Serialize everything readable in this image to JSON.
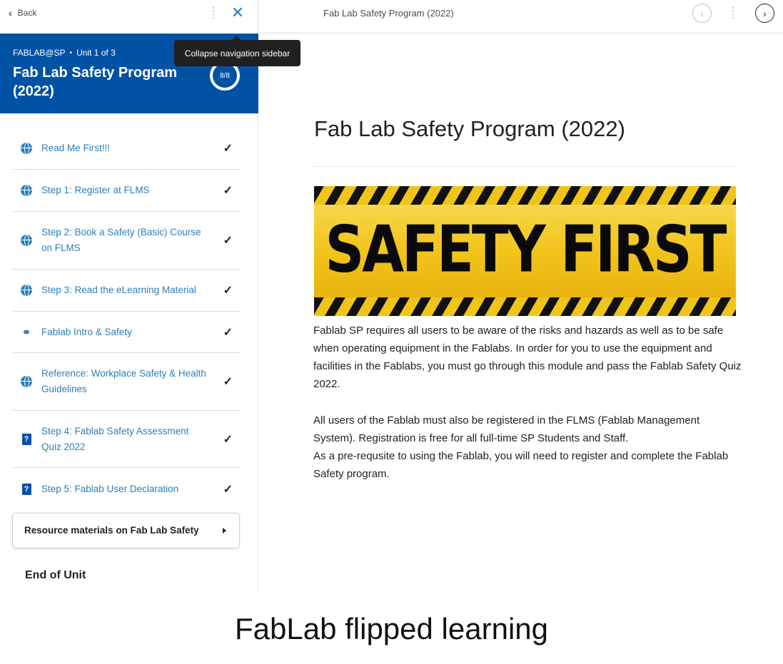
{
  "sidebar": {
    "back_label": "Back",
    "close_tooltip": "Collapse navigation sidebar",
    "unit": {
      "org": "FABLAB@SP",
      "unit_index": "Unit 1 of 3",
      "title": "Fab Lab Safety Program (2022)",
      "progress": "8/8"
    },
    "items": [
      {
        "label": "Read Me First!!!",
        "icon": "globe-icon",
        "completed": true
      },
      {
        "label": "Step 1: Register at FLMS",
        "icon": "globe-icon",
        "completed": true
      },
      {
        "label": "Step 2: Book a Safety (Basic) Course on FLMS",
        "icon": "globe-icon",
        "completed": true
      },
      {
        "label": "Step 3: Read the eLearning Material",
        "icon": "globe-icon",
        "completed": true
      },
      {
        "label": "Fablab Intro & Safety",
        "icon": "link-icon",
        "completed": true
      },
      {
        "label": "Reference: Workplace Safety & Health Guidelines",
        "icon": "globe-icon",
        "completed": true
      },
      {
        "label": "Step 4: Fablab Safety Assessment Quiz 2022",
        "icon": "quiz-icon",
        "completed": true
      },
      {
        "label": "Step 5: Fablab User Declaration",
        "icon": "quiz-icon",
        "completed": true
      }
    ],
    "check_glyph": "✓",
    "resource_section": "Resource materials on Fab Lab Safety",
    "end_label": "End of Unit"
  },
  "main": {
    "topbar_title": "Fab Lab Safety Program (2022)",
    "content_title": "Fab Lab Safety Program (2022)",
    "banner_text": "SAFETY FIRST",
    "paragraph1": "Fablab SP requires all users to be aware of the risks and hazards as well as to be safe when operating equipment in the Fablabs.  In order for you to use the equipment and facilities in the Fablabs, you must go through this module and pass the Fablab Safety Quiz 2022.",
    "paragraph2": "All users of the Fablab must also be registered in the FLMS (Fablab Management System).  Registration is free for all full-time SP Students and Staff.",
    "paragraph3": "As a pre-requsite to using the Fablab, you will need to register and complete the Fablab Safety program."
  },
  "caption": "FabLab flipped learning",
  "colors": {
    "brand_blue": "#0052a5",
    "link_blue": "#2d7fb8",
    "banner_yellow": "#f0c419"
  }
}
